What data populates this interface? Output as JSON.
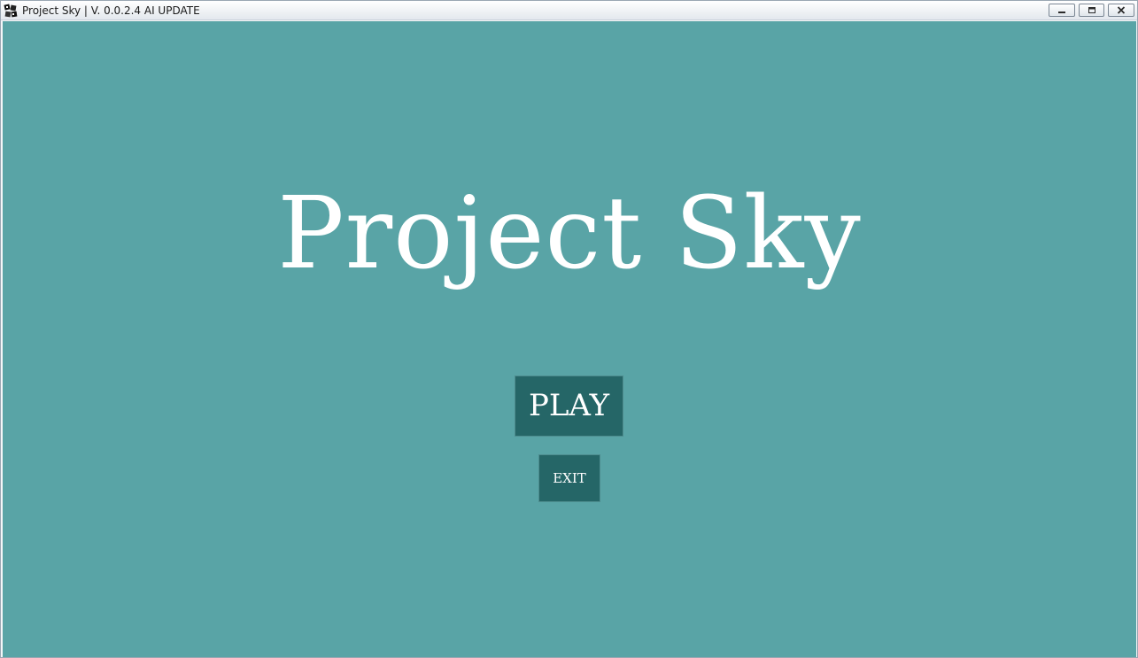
{
  "window": {
    "title": "Project Sky | V. 0.0.2.4 AI UPDATE",
    "icon": "app-icon",
    "controls": [
      "minimize-icon",
      "maximize-icon",
      "close-icon"
    ]
  },
  "menu": {
    "game_title": "Project Sky",
    "play_label": "PLAY",
    "exit_label": "EXIT"
  },
  "colors": {
    "background": "#59a4a6",
    "button": "#256667",
    "text": "#ffffff"
  }
}
